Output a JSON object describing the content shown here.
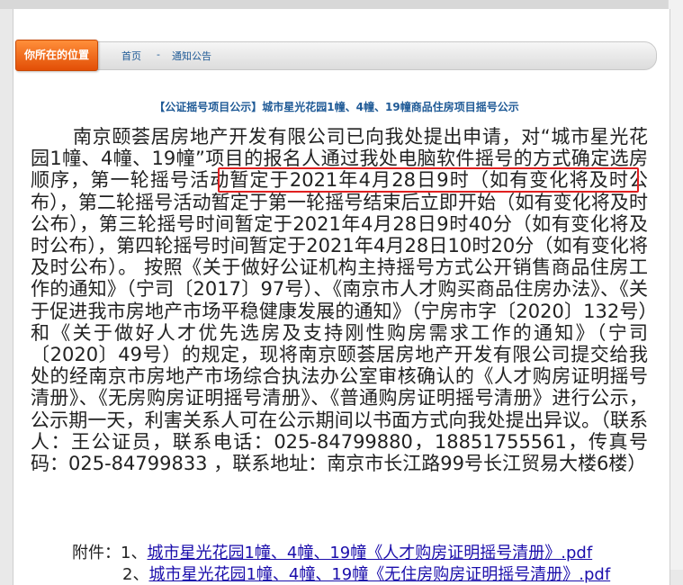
{
  "location_label": "你所在的位置",
  "breadcrumb": {
    "home": "首页",
    "separator": "-",
    "current": "通知公告"
  },
  "article": {
    "title": "【公证摇号项目公示】城市星光花园1幢、4幢、19幢商品住房项目摇号公示",
    "body": "南京颐荟居房地产开发有限公司已向我处提出申请，对“城市星光花园1幢、4幢、19幢”项目的报名人通过我处电脑软件摇号的方式确定选房顺序，第一轮摇号活动暂定于2021年4月28日9时（如有变化将及时公布），第二轮摇号活动暂定于第一轮摇号结束后立即开始（如有变化将及时公布），第三轮摇号时间暂定于2021年4月28日9时40分（如有变化将及时公布），第四轮摇号时间暂定于2021年4月28日10时20分（如有变化将及时公布）。 按照《关于做好公证机构主持摇号方式公开销售商品住房工作的通知》（宁司〔2017〕97号）、《南京市人才购买商品住房办法》、《关于促进我市房地产市场平稳健康发展的通知》（宁房市字〔2020〕132号）和《关于做好人才优先选房及支持刚性购房需求工作的通知》（宁司〔2020〕49号）的规定，现将南京颐荟居房地产开发有限公司提交给我处的经南京市房地产市场综合执法办公室审核确认的《人才购房证明摇号清册》、《无房购房证明摇号清册》、《普通购房证明摇号清册》进行公示，公示期一天，利害关系人可在公示期间以书面方式向我处提出异议。（联系人：王公证员，联系电话：025-84799880，18851755561，传真号码：025-84799833 ，联系地址：南京市长江路99号长江贸易大楼6楼）"
  },
  "attachments": {
    "label": "附件：1、",
    "items": [
      {
        "prefix": "附件：1、",
        "text": "城市星光花园1幢、4幢、19幢《人才购房证明摇号清册》.pdf"
      },
      {
        "prefix": "2、",
        "text": "城市星光花园1幢、4幢、19幢《无住房购房证明摇号清册》.pdf"
      }
    ]
  },
  "colors": {
    "accent": "#e85a0c",
    "link": "#1a0dab",
    "title": "#1f5a96",
    "highlight_box": "#e02020"
  }
}
